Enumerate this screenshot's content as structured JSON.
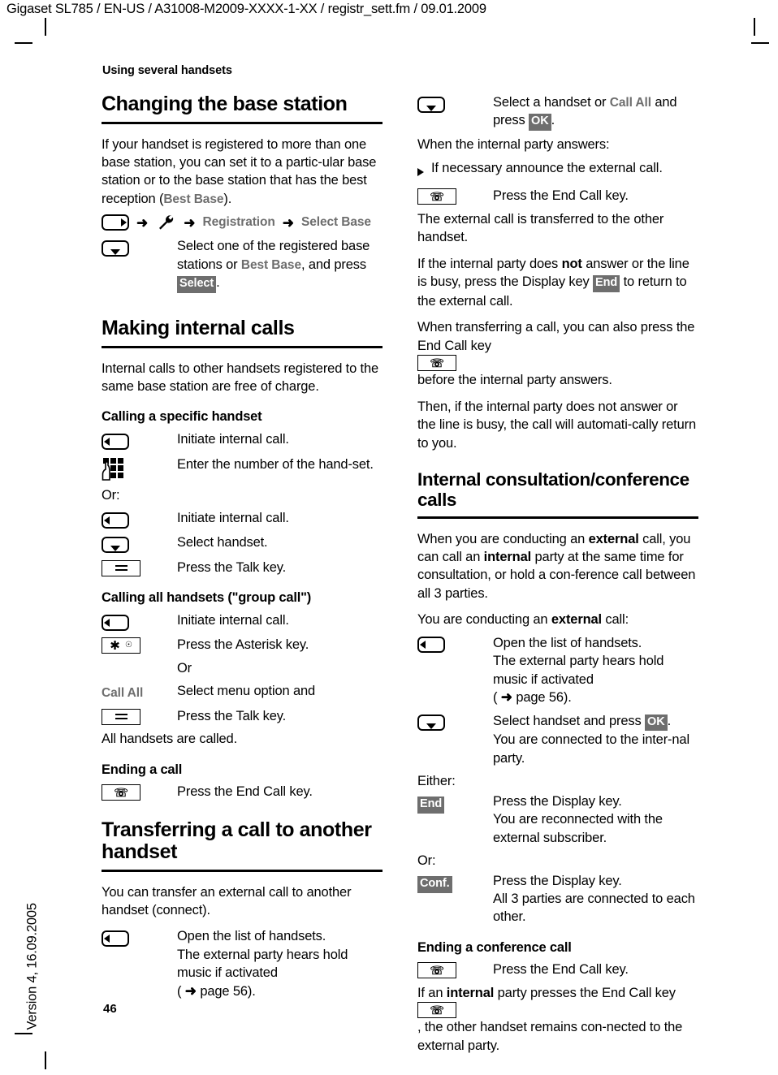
{
  "page": {
    "doc_header": "Gigaset SL785 / EN-US / A31008-M2009-XXXX-1-XX / registr_sett.fm / 09.01.2009",
    "side_version": "Version 4, 16.09.2005",
    "page_number": "46",
    "running_head": "Using several handsets"
  },
  "left": {
    "s1": {
      "heading": "Changing the base station",
      "p1": "If your handset is registered to more than one base station, you can set it to a partic-ular base station or to the base station that has the best reception (",
      "p1_menu": "Best Base",
      "p1_end": ").",
      "menu_path": {
        "icon1": "display-key-right-icon",
        "icon2": "wrench-settings-icon",
        "item1": "Registration",
        "item2": "Select Base",
        "arrow": "➜"
      },
      "row1": {
        "icon": "nav-key-down-icon",
        "text_a": "Select one of the registered base stations or ",
        "menu": "Best Base",
        "text_b": ", and press ",
        "badge": "Select",
        "text_c": "."
      }
    },
    "s2": {
      "heading": "Making internal calls",
      "p1": "Internal calls to other handsets registered to the same base station are free of charge.",
      "sub1": "Calling a specific handset",
      "r1": {
        "icon": "display-key-left-icon",
        "text": "Initiate internal call."
      },
      "r2": {
        "icon": "keypad-icon",
        "text": "Enter the number of the hand-set."
      },
      "or_label": "Or:",
      "r3": {
        "icon": "display-key-left-icon",
        "text": "Initiate internal call."
      },
      "r4": {
        "icon": "nav-key-down-icon",
        "text": "Select handset."
      },
      "r5": {
        "icon": "talk-key-icon",
        "text": "Press the Talk key."
      },
      "sub2": "Calling all handsets (\"group call\")",
      "r6": {
        "icon": "display-key-left-icon",
        "text": "Initiate internal call."
      },
      "r7": {
        "icon": "asterisk-key-icon",
        "text": "Press the Asterisk key."
      },
      "r8": {
        "text": "Or"
      },
      "r9": {
        "menu": "Call All",
        "text": "Select menu option and"
      },
      "r10": {
        "icon": "talk-key-icon",
        "text": "Press the Talk key."
      },
      "p2": "All handsets are called."
    },
    "s3": {
      "sub": "Ending a call",
      "r1": {
        "icon": "end-call-key-icon",
        "text": "Press the End Call key."
      }
    },
    "s4": {
      "heading": "Transferring a call to another handset",
      "p1": "You can transfer an external call to another handset (connect).",
      "r1": {
        "icon": "display-key-left-icon",
        "line1": "Open the list of handsets.",
        "line2": "The external party hears hold",
        "line3": "music if activated",
        "line4_pre": "( ",
        "line4_arrow": "➜",
        "line4_post": " page 56)."
      }
    }
  },
  "right": {
    "r1": {
      "icon": "nav-key-down-icon",
      "text_a": "Select a handset or ",
      "menu": "Call All",
      "text_b": " and press ",
      "badge": "OK",
      "text_c": "."
    },
    "p1": "When the internal party answers:",
    "bullet1": "If necessary announce the external call.",
    "r2": {
      "icon": "end-call-key-icon",
      "text": "Press the End Call key."
    },
    "p2": "The external call is transferred to the other handset.",
    "p3_a": "If the internal party does ",
    "p3_b": "not",
    "p3_c": " answer or the line is busy, press the Display key ",
    "p3_badge": "End",
    "p3_d": " to return to the external call.",
    "p4_a": "When transferring a call, you can also press the End Call key ",
    "p4_icon": "end-call-key-icon",
    "p4_b": " before the internal party answers.",
    "p5": "Then, if the internal party does not answer or the line is busy, the call will automati-cally return to you.",
    "s5": {
      "heading": "Internal consultation/conference calls",
      "p1_a": "When you are conducting an ",
      "p1_b": "external",
      "p1_c": " call, you can call an ",
      "p1_d": "internal",
      "p1_e": " party at the same time for consultation, or hold a con-ference call between all 3 parties.",
      "p2_a": "You are conducting an ",
      "p2_b": "external",
      "p2_c": " call:",
      "r1": {
        "icon": "display-key-left-icon",
        "line1": "Open the list of handsets.",
        "line2": "The external party hears hold",
        "line3": "music if activated",
        "line4_pre": "( ",
        "line4_arrow": "➜",
        "line4_post": " page 56)."
      },
      "r2": {
        "icon": "nav-key-down-icon",
        "line1_a": "Select handset and press ",
        "line1_badge": "OK",
        "line1_b": ".",
        "line2": "You are connected to the inter-nal party."
      },
      "either_label": "Either:",
      "r3": {
        "badge": "End",
        "line1": "Press the Display key.",
        "line2": "You are reconnected with the external subscriber."
      },
      "or_label": "Or:",
      "r4": {
        "badge": "Conf.",
        "line1": "Press the Display key.",
        "line2": "All 3 parties are connected to each other."
      }
    },
    "s6": {
      "sub": "Ending a conference call",
      "r1": {
        "icon": "end-call-key-icon",
        "text": "Press the End Call key."
      },
      "p1_a": "If an ",
      "p1_b": "internal",
      "p1_c": " party presses the End Call key ",
      "p1_icon": "end-call-key-icon",
      "p1_d": ", the other handset remains con-nected to the external party."
    }
  },
  "colors": {
    "menu_grey": "#6e6e6e",
    "badge_bg": "#6e6e6e",
    "badge_fg": "#ffffff",
    "text": "#000000"
  }
}
